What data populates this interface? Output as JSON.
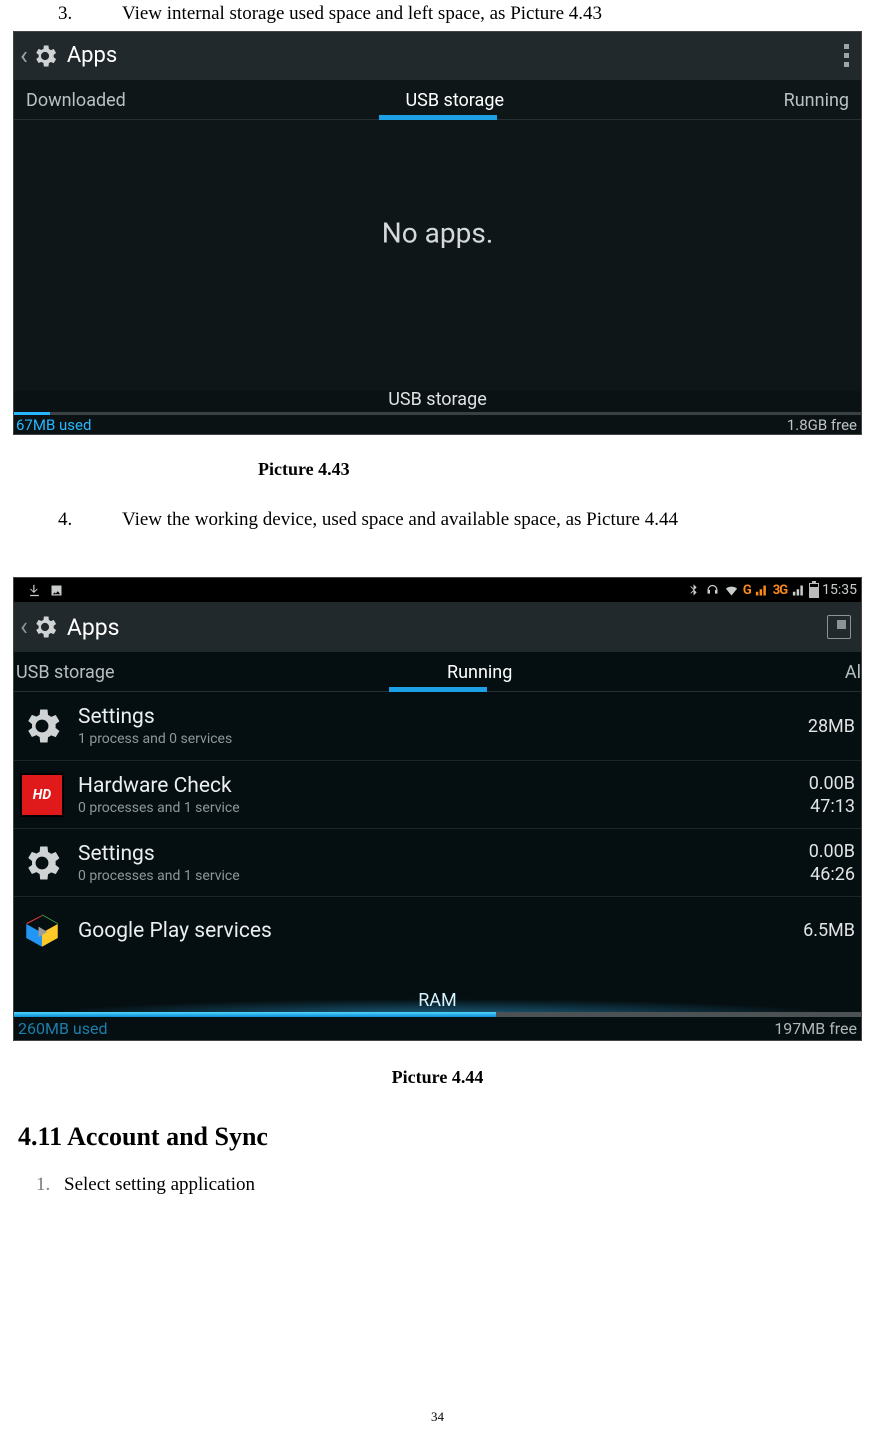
{
  "instructions": {
    "three": {
      "num": "3.",
      "text": "View internal storage used space and left space, as Picture 4.43"
    },
    "four": {
      "num": "4.",
      "text": "View the working device, used space and available space, as Picture 4.44"
    }
  },
  "captions": {
    "p443": "Picture 4.43",
    "p444": "Picture 4.44"
  },
  "shot1": {
    "title": "Apps",
    "tabs": {
      "downloaded": "Downloaded",
      "usb": "USB storage",
      "running": "Running"
    },
    "empty": "No apps.",
    "storage_label": "USB storage",
    "used": "67MB used",
    "free": "1.8GB free"
  },
  "shot2": {
    "status": {
      "time": "15:35",
      "net_label": "G",
      "net_3g": "3G"
    },
    "title": "Apps",
    "tabs": {
      "usb": "USB storage",
      "running": "Running",
      "all": "Al"
    },
    "apps": [
      {
        "icon": "gear",
        "name": "Settings",
        "sub": "1 process and 0 services",
        "size": "28MB",
        "time": ""
      },
      {
        "icon": "hd",
        "name": "Hardware Check",
        "sub": "0 processes and 1 service",
        "size": "0.00B",
        "time": "47:13"
      },
      {
        "icon": "gear",
        "name": "Settings",
        "sub": "0 processes and 1 service",
        "size": "0.00B",
        "time": "46:26"
      },
      {
        "icon": "play",
        "name": "Google Play services",
        "sub": "",
        "size": "6.5MB",
        "time": ""
      }
    ],
    "ram_label": "RAM",
    "used": "260MB used",
    "free": "197MB free"
  },
  "icons": {
    "hd_label": "HD"
  },
  "section": {
    "title": "4.11 Account and Sync",
    "step1_num": "1.",
    "step1_text": "Select setting application"
  },
  "page_number": "34"
}
